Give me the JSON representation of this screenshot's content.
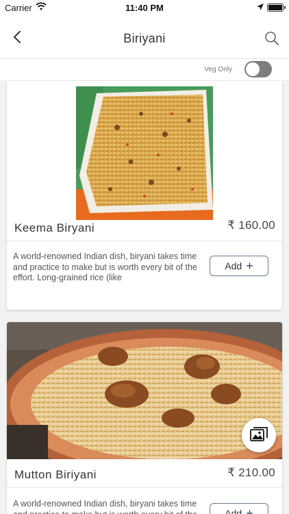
{
  "status_bar": {
    "carrier": "Carrier",
    "time": "11:40 PM"
  },
  "header": {
    "title": "Biriyani",
    "back_icon": "chevron-left-icon",
    "search_icon": "search-icon"
  },
  "filter": {
    "veg_only_label": "Veg Only",
    "veg_only_enabled": false
  },
  "items": [
    {
      "name": "Keema Biryani",
      "price": "₹ 160.00",
      "description": "A world-renowned Indian dish, biryani takes time and practice to make but is worth every bit of the effort. Long-grained rice (like",
      "add_label": "Add"
    },
    {
      "name": "Mutton Biriyani",
      "price": "₹ 210.00",
      "description": "A world-renowned Indian dish, biryani takes time and practice to make but is worth every bit of the effort.",
      "add_label": "Add"
    }
  ],
  "colors": {
    "accent": "#2d4a7a",
    "toggle_off": "#7d7d7d",
    "background": "#f2f2f2"
  }
}
